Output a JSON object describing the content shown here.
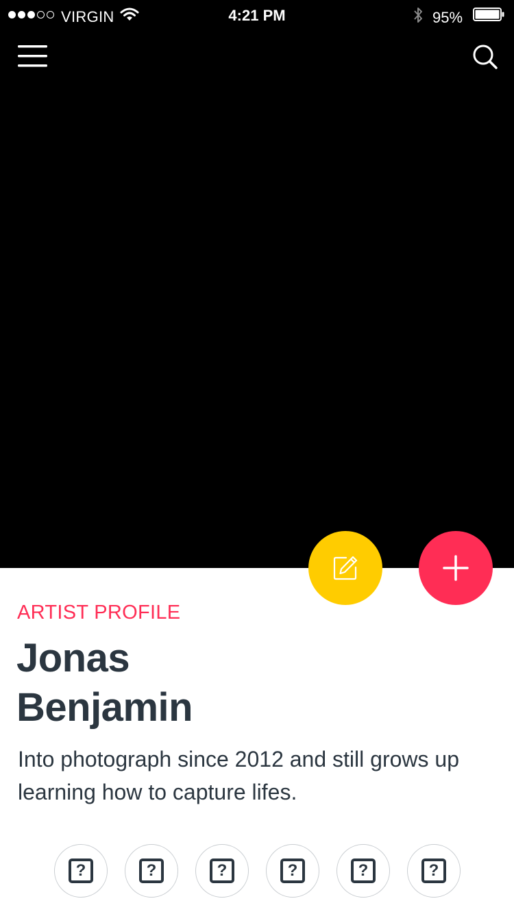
{
  "status_bar": {
    "carrier": "VIRGIN",
    "time": "4:21 PM",
    "battery": "95%",
    "signal_bars_filled": 3,
    "signal_bars_total": 5
  },
  "nav": {
    "menu_icon": "hamburger-menu-icon",
    "search_icon": "search-icon"
  },
  "hero": {
    "background": "#000000"
  },
  "actions": {
    "edit_icon": "edit-pencil-icon",
    "add_icon": "plus-icon",
    "edit_color": "#ffcc00",
    "add_color": "#ff2d55"
  },
  "profile": {
    "section_label": "ARTIST PROFILE",
    "name_first": "Jonas",
    "name_last": "Benjamin",
    "bio": "Into photograph since 2012 and still grows up learning how to capture lifes."
  },
  "social_links": [
    {
      "icon": "unknown-icon",
      "glyph": "?"
    },
    {
      "icon": "unknown-icon",
      "glyph": "?"
    },
    {
      "icon": "unknown-icon",
      "glyph": "?"
    },
    {
      "icon": "unknown-icon",
      "glyph": "?"
    },
    {
      "icon": "unknown-icon",
      "glyph": "?"
    },
    {
      "icon": "unknown-icon",
      "glyph": "?"
    }
  ],
  "colors": {
    "accent": "#ff2d55",
    "text_dark": "#2b3640",
    "yellow": "#ffcc00"
  }
}
